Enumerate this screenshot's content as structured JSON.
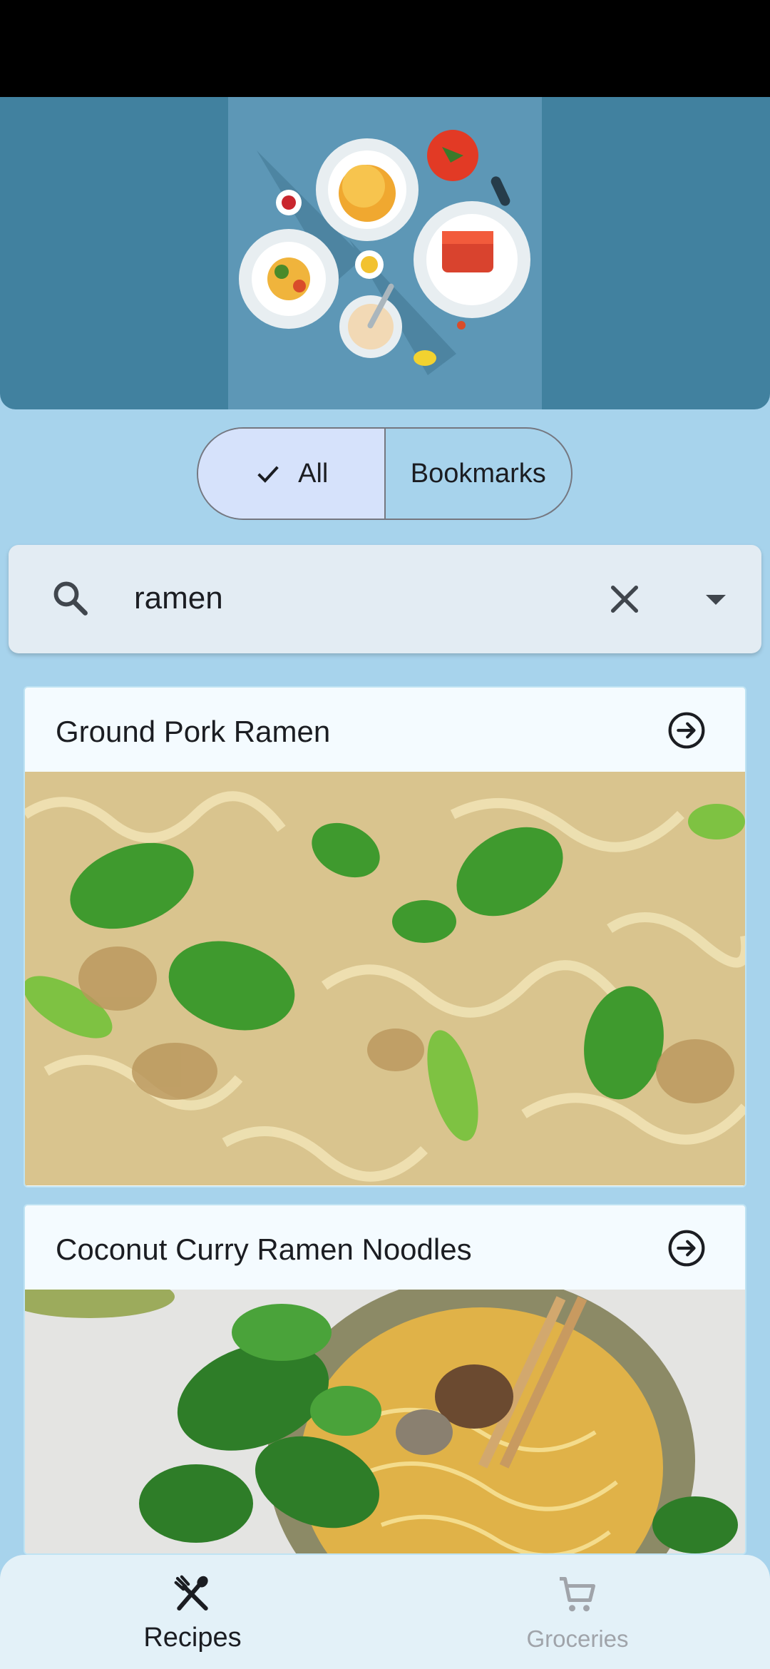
{
  "filter": {
    "all_label": "All",
    "bookmarks_label": "Bookmarks",
    "selected": "All"
  },
  "search": {
    "query": "ramen"
  },
  "recipes": [
    {
      "title": "Ground Pork Ramen"
    },
    {
      "title": "Coconut Curry Ramen Noodles"
    }
  ],
  "nav": {
    "recipes_label": "Recipes",
    "groceries_label": "Groceries",
    "active": "Recipes"
  },
  "colors": {
    "background": "#a7d3ec",
    "hero": "#41819f",
    "selected_chip": "#d6e2fb",
    "nav_bg": "#e3f1f8"
  }
}
